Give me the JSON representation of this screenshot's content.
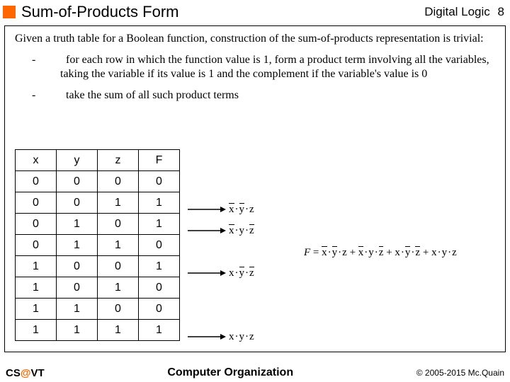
{
  "header": {
    "title": "Sum-of-Products Form",
    "course": "Digital Logic",
    "page": "8"
  },
  "intro": "Given a truth table for a Boolean function, construction of the sum-of-products representation is trivial:",
  "bullets": [
    "for each row in which the function value is 1, form a product term involving all the variables, taking the variable if its value is 1 and the complement if the variable's value is 0",
    "take the sum of all such product terms"
  ],
  "table": {
    "headers": [
      "x",
      "y",
      "z",
      "F"
    ],
    "rows": [
      [
        "0",
        "0",
        "0",
        "0"
      ],
      [
        "0",
        "0",
        "1",
        "1"
      ],
      [
        "0",
        "1",
        "0",
        "1"
      ],
      [
        "0",
        "1",
        "1",
        "0"
      ],
      [
        "1",
        "0",
        "0",
        "1"
      ],
      [
        "1",
        "0",
        "1",
        "0"
      ],
      [
        "1",
        "1",
        "0",
        "0"
      ],
      [
        "1",
        "1",
        "1",
        "1"
      ]
    ]
  },
  "terms": {
    "r1": {
      "x_bar": true,
      "y_bar": true,
      "z_bar": false
    },
    "r2": {
      "x_bar": true,
      "y_bar": false,
      "z_bar": true
    },
    "r4": {
      "x_bar": false,
      "y_bar": true,
      "z_bar": true
    },
    "r7": {
      "x_bar": false,
      "y_bar": false,
      "z_bar": false
    }
  },
  "vars": {
    "x": "x",
    "y": "y",
    "z": "z",
    "F": "F",
    "eq": "="
  },
  "footer": {
    "left_cs": "CS",
    "left_at": "@",
    "left_vt": "VT",
    "center": "Computer Organization",
    "right": "© 2005-2015 Mc.Quain"
  }
}
